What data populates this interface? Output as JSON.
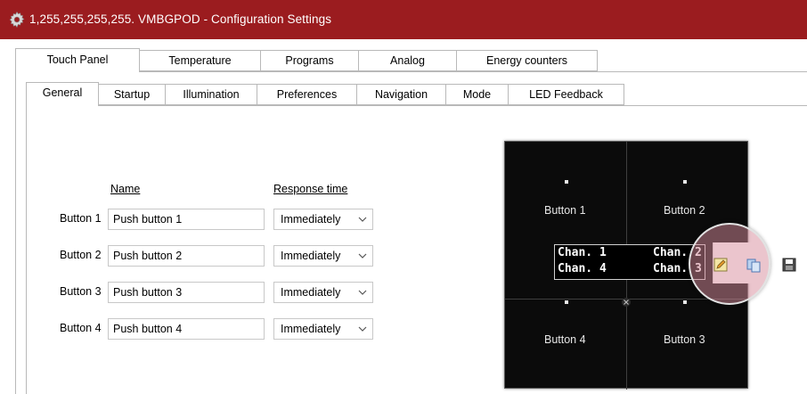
{
  "window": {
    "title": "1,255,255,255,255. VMBGPOD - Configuration Settings",
    "title_bg": "#9b1c1f"
  },
  "main_tabs": [
    {
      "label": "Touch Panel",
      "active": true
    },
    {
      "label": "Temperature",
      "active": false
    },
    {
      "label": "Programs",
      "active": false
    },
    {
      "label": "Analog",
      "active": false
    },
    {
      "label": "Energy counters",
      "active": false
    }
  ],
  "sub_tabs": [
    {
      "label": "General",
      "active": true
    },
    {
      "label": "Startup",
      "active": false
    },
    {
      "label": "Illumination",
      "active": false
    },
    {
      "label": "Preferences",
      "active": false
    },
    {
      "label": "Navigation",
      "active": false
    },
    {
      "label": "Mode",
      "active": false
    },
    {
      "label": "LED Feedback",
      "active": false
    }
  ],
  "general": {
    "name_header": "Name",
    "response_header": "Response time",
    "buttons": [
      {
        "label": "Button 1",
        "name": "Push button 1",
        "response": "Immediately"
      },
      {
        "label": "Button 2",
        "name": "Push button 2",
        "response": "Immediately"
      },
      {
        "label": "Button 3",
        "name": "Push button 3",
        "response": "Immediately"
      },
      {
        "label": "Button 4",
        "name": "Push button 4",
        "response": "Immediately"
      }
    ]
  },
  "device": {
    "top_left": "Button 1",
    "top_right": "Button 2",
    "bottom_left": "Button 4",
    "bottom_right": "Button 3",
    "chan1": "Chan. 1",
    "chan2": "Chan. 2",
    "chan3": "Chan. 3",
    "chan4": "Chan. 4"
  },
  "toolbar": {
    "icons": [
      "edit-icon",
      "copy-icon",
      "save-icon"
    ]
  }
}
